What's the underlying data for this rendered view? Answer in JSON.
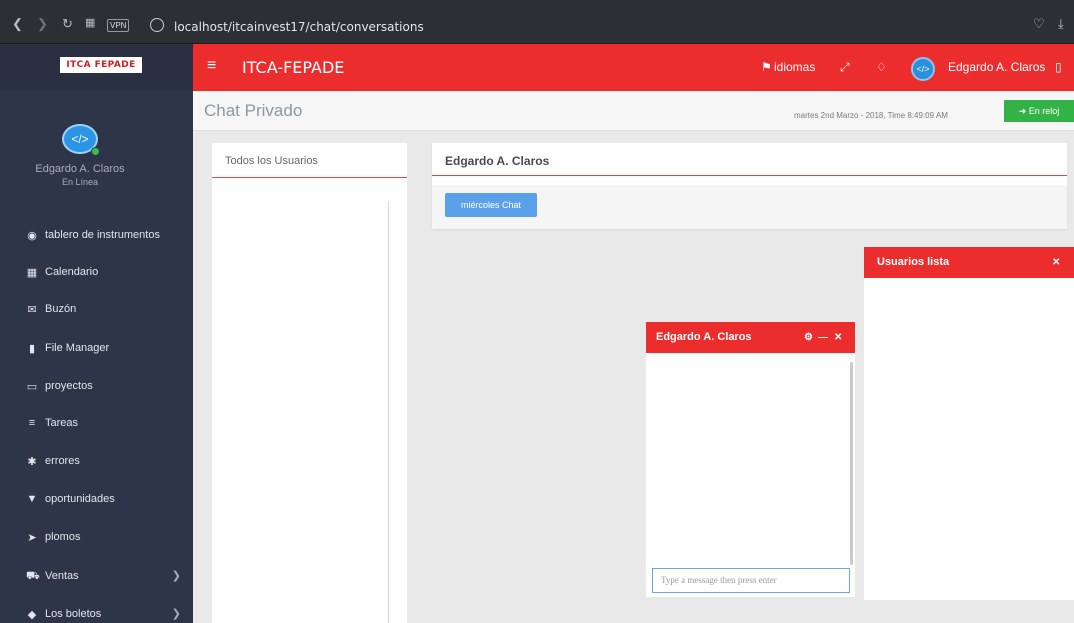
{
  "browser": {
    "url": "localhost/itcainvest17/chat/conversations",
    "vpn": "VPN"
  },
  "navbar": {
    "brand": "ITCA-FEPADE",
    "languages": "idiomas",
    "user_name": "Edgardo A. Claros",
    "avatar_glyph": "</>"
  },
  "sidebar": {
    "logo_text": "ITCA FEPADE",
    "avatar_glyph": "</>",
    "user_name": "Edgardo A. Claros",
    "user_status": "En Línea",
    "items": [
      {
        "label": "tablero de instrumentos",
        "icon": "dashboard-icon",
        "glyph": "◉"
      },
      {
        "label": "Calendario",
        "icon": "calendar-icon",
        "glyph": "▦"
      },
      {
        "label": "Buzón",
        "icon": "envelope-icon",
        "glyph": "✉"
      },
      {
        "label": "File Manager",
        "icon": "file-icon",
        "glyph": "▮"
      },
      {
        "label": "proyectos",
        "icon": "folder-icon",
        "glyph": "▭"
      },
      {
        "label": "Tareas",
        "icon": "tasks-icon",
        "glyph": "≡"
      },
      {
        "label": "errores",
        "icon": "bug-icon",
        "glyph": "✱"
      },
      {
        "label": "oportunidades",
        "icon": "filter-icon",
        "glyph": "▼"
      },
      {
        "label": "plomos",
        "icon": "send-icon",
        "glyph": "➤"
      },
      {
        "label": "Ventas",
        "icon": "cart-icon",
        "glyph": "⛟"
      },
      {
        "label": "Los boletos",
        "icon": "ticket-icon",
        "glyph": "◆"
      }
    ]
  },
  "header": {
    "title": "Chat Privado",
    "datetime": "martes 2nd Marzo - 2018,  Time  8:49:09 AM",
    "clock_button": "En reloj"
  },
  "users_panel": {
    "title": "Todos los Usuarios"
  },
  "chat_panel": {
    "title": "Edgardo A. Claros",
    "button": "miércoles Chat"
  },
  "chat_window": {
    "name": "Edgardo A. Claros",
    "input_placeholder": "Type a message then press enter"
  },
  "users_list": {
    "title": "Usuarios lista"
  },
  "colors": {
    "accent_red": "#ec2d2e",
    "sidebar": "#2f3548",
    "success_green": "#33b245",
    "button_blue": "#5ba1ea"
  }
}
